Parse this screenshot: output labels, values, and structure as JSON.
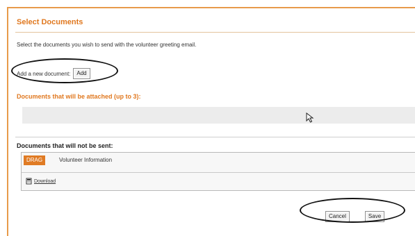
{
  "panel": {
    "title": "Select Documents",
    "intro": "Select the documents you wish to send with the volunteer greeting email.",
    "add_label": "Add a new document:",
    "add_button": "Add",
    "attached_header": "Documents that will be attached (up to 3):",
    "not_sent_header": "Documents that will not be sent:",
    "documents": [
      {
        "drag_tag": "DRAG",
        "name": "Volunteer Information",
        "download": "Download"
      }
    ],
    "cancel_button": "Cancel",
    "save_button": "Save"
  },
  "colors": {
    "accent": "#e0781f",
    "border": "#e89a4a",
    "drop_zone": "#ececec"
  },
  "icons": [
    "mouse-cursor-icon",
    "download-icon"
  ]
}
